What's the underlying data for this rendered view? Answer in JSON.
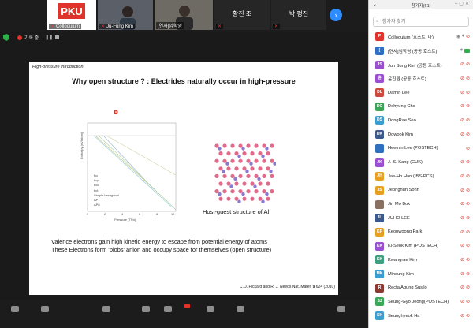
{
  "meeting": {
    "recording_label": "기록 중...",
    "next_page_icon": "chevron-right-icon"
  },
  "video_tiles": [
    {
      "name": "Colloquium",
      "logo_text": "PKU"
    },
    {
      "name": "Ju-Fung Kim"
    },
    {
      "name": "[연사]임학영"
    },
    {
      "name": "황진 조"
    },
    {
      "name": "박 평진"
    }
  ],
  "slide": {
    "header": "High-pressure introduction",
    "title": "Why open structure ? : Electrides naturally occur in high-pressure",
    "plot": {
      "ylabel": "Enthalpy (eV/atom)",
      "xlabel": "Pressure (TPa)",
      "x_ticks": [
        "0",
        "2",
        "4",
        "6",
        "8",
        "10"
      ],
      "legend": [
        "fcc",
        "hcp",
        "bcc",
        "bct",
        "Simple hexagonal",
        "AP7",
        "AP8"
      ]
    },
    "image_caption": "Host-guest structure of Al",
    "para1": "Valence electrons gain high kinetic energy to escape from potential energy of atoms",
    "para2": "These Electrons form ‘blobs’ anion and occupy space for themselves (open structure)",
    "cite_prefix": "C. J. Pickard and R. J. Needs Nat. Mater. ",
    "cite_vol": "9",
    "cite_suffix": " 624 (2010)"
  },
  "panel": {
    "title": "참가자(61)",
    "search_placeholder": "참가자 찾기",
    "participants": [
      {
        "initials": "P",
        "color": "#e0332b",
        "name": "Colloquium (호스트, 나)"
      },
      {
        "initials": "[",
        "color": "#3070c0",
        "name": "[연사]임학영 (공동 호스트)"
      },
      {
        "initials": "JS",
        "color": "#9b4fd0",
        "name": "Jun Sung Kim (공동 호스트)"
      },
      {
        "initials": "윤",
        "color": "#9b4fd0",
        "name": "윤진원 (공동 호스트)"
      },
      {
        "initials": "DL",
        "color": "#d0483c",
        "name": "Damin Lee"
      },
      {
        "initials": "DC",
        "color": "#3aa757",
        "name": "Dohyung Cho"
      },
      {
        "initials": "DS",
        "color": "#3a9fd0",
        "name": "DongRae Seo"
      },
      {
        "initials": "DK",
        "color": "#3a5a8c",
        "name": "Dowook Kim"
      },
      {
        "initials": "",
        "color": "#3070c0",
        "name": "Heemin Lee (POSTECH)"
      },
      {
        "initials": "JK",
        "color": "#9b4fd0",
        "name": "J.-S. Kang (CUK)"
      },
      {
        "initials": "JH",
        "color": "#e8a020",
        "name": "Jae-Ho Han (IBS-PCS)"
      },
      {
        "initials": "JS",
        "color": "#e8a020",
        "name": "Jeonghun Sohn"
      },
      {
        "initials": "",
        "color": "#8a7060",
        "name": "Jin Mo Bok"
      },
      {
        "initials": "JL",
        "color": "#3a5a8c",
        "name": "JUHO LEE"
      },
      {
        "initials": "KP",
        "color": "#e8a020",
        "name": "Keonwoong Park"
      },
      {
        "initials": "KK",
        "color": "#9b4fd0",
        "name": "Ki-Seok Kim (POSTECH)"
      },
      {
        "initials": "KK",
        "color": "#3aa080",
        "name": "Kwangrae Kim"
      },
      {
        "initials": "MK",
        "color": "#3a9fd0",
        "name": "Minsung Kim"
      },
      {
        "initials": "R",
        "color": "#8a3a30",
        "name": "Recta Agung Susilo"
      },
      {
        "initials": "SJ",
        "color": "#3aa757",
        "name": "Seung-Gyo Jeong(POSTECH)"
      },
      {
        "initials": "SH",
        "color": "#3a9fd0",
        "name": "Seunghyeok Ha"
      }
    ]
  }
}
